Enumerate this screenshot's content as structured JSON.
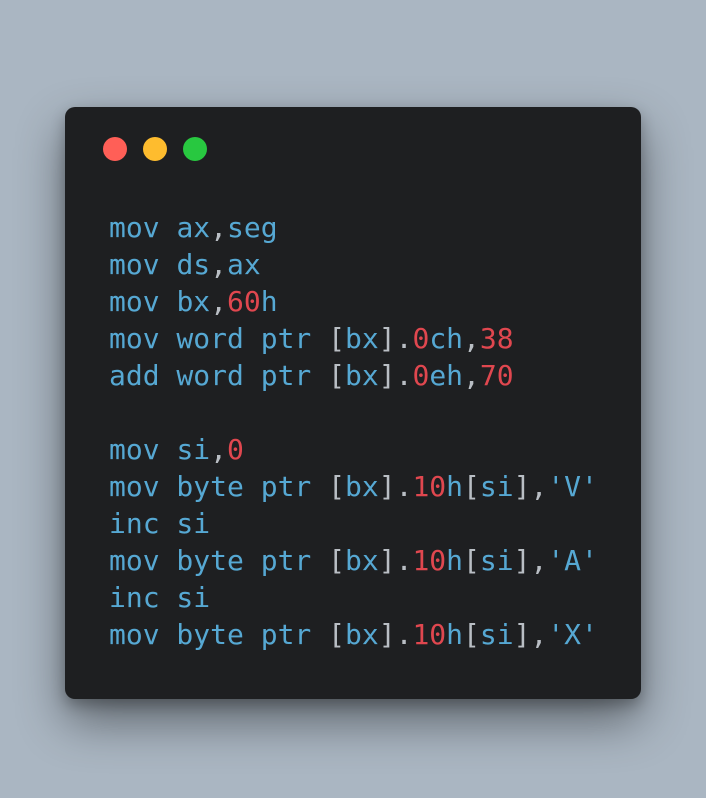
{
  "colors": {
    "background": "#aab6c2",
    "window": "#1e1f21",
    "dot_close": "#ff5f57",
    "dot_minimize": "#febc2e",
    "dot_maximize": "#28c840",
    "keyword": "#56a8d3",
    "number": "#e0474f",
    "punctuation": "#b9bec4"
  },
  "code": {
    "lines": [
      {
        "tokens": [
          {
            "t": "mov ",
            "k": "kw"
          },
          {
            "t": "ax",
            "k": "kw"
          },
          {
            "t": ",",
            "k": "p"
          },
          {
            "t": "seg",
            "k": "kw"
          }
        ]
      },
      {
        "tokens": [
          {
            "t": "mov ",
            "k": "kw"
          },
          {
            "t": "ds",
            "k": "kw"
          },
          {
            "t": ",",
            "k": "p"
          },
          {
            "t": "ax",
            "k": "kw"
          }
        ]
      },
      {
        "tokens": [
          {
            "t": "mov ",
            "k": "kw"
          },
          {
            "t": "bx",
            "k": "kw"
          },
          {
            "t": ",",
            "k": "p"
          },
          {
            "t": "60",
            "k": "num"
          },
          {
            "t": "h",
            "k": "kw"
          }
        ]
      },
      {
        "tokens": [
          {
            "t": "mov word ptr ",
            "k": "kw"
          },
          {
            "t": "[",
            "k": "p"
          },
          {
            "t": "bx",
            "k": "kw"
          },
          {
            "t": "].",
            "k": "p"
          },
          {
            "t": "0",
            "k": "num"
          },
          {
            "t": "ch",
            "k": "kw"
          },
          {
            "t": ",",
            "k": "p"
          },
          {
            "t": "38",
            "k": "num"
          }
        ]
      },
      {
        "tokens": [
          {
            "t": "add word ptr ",
            "k": "kw"
          },
          {
            "t": "[",
            "k": "p"
          },
          {
            "t": "bx",
            "k": "kw"
          },
          {
            "t": "].",
            "k": "p"
          },
          {
            "t": "0",
            "k": "num"
          },
          {
            "t": "eh",
            "k": "kw"
          },
          {
            "t": ",",
            "k": "p"
          },
          {
            "t": "70",
            "k": "num"
          }
        ]
      },
      {
        "tokens": []
      },
      {
        "tokens": [
          {
            "t": "mov ",
            "k": "kw"
          },
          {
            "t": "si",
            "k": "kw"
          },
          {
            "t": ",",
            "k": "p"
          },
          {
            "t": "0",
            "k": "num"
          }
        ]
      },
      {
        "tokens": [
          {
            "t": "mov byte ptr ",
            "k": "kw"
          },
          {
            "t": "[",
            "k": "p"
          },
          {
            "t": "bx",
            "k": "kw"
          },
          {
            "t": "].",
            "k": "p"
          },
          {
            "t": "10",
            "k": "num"
          },
          {
            "t": "h",
            "k": "kw"
          },
          {
            "t": "[",
            "k": "p"
          },
          {
            "t": "si",
            "k": "kw"
          },
          {
            "t": "],",
            "k": "p"
          },
          {
            "t": "'V'",
            "k": "kw"
          }
        ]
      },
      {
        "tokens": [
          {
            "t": "inc si",
            "k": "kw"
          }
        ]
      },
      {
        "tokens": [
          {
            "t": "mov byte ptr ",
            "k": "kw"
          },
          {
            "t": "[",
            "k": "p"
          },
          {
            "t": "bx",
            "k": "kw"
          },
          {
            "t": "].",
            "k": "p"
          },
          {
            "t": "10",
            "k": "num"
          },
          {
            "t": "h",
            "k": "kw"
          },
          {
            "t": "[",
            "k": "p"
          },
          {
            "t": "si",
            "k": "kw"
          },
          {
            "t": "],",
            "k": "p"
          },
          {
            "t": "'A'",
            "k": "kw"
          }
        ]
      },
      {
        "tokens": [
          {
            "t": "inc si",
            "k": "kw"
          }
        ]
      },
      {
        "tokens": [
          {
            "t": "mov byte ptr ",
            "k": "kw"
          },
          {
            "t": "[",
            "k": "p"
          },
          {
            "t": "bx",
            "k": "kw"
          },
          {
            "t": "].",
            "k": "p"
          },
          {
            "t": "10",
            "k": "num"
          },
          {
            "t": "h",
            "k": "kw"
          },
          {
            "t": "[",
            "k": "p"
          },
          {
            "t": "si",
            "k": "kw"
          },
          {
            "t": "],",
            "k": "p"
          },
          {
            "t": "'X'",
            "k": "kw"
          }
        ]
      }
    ]
  }
}
